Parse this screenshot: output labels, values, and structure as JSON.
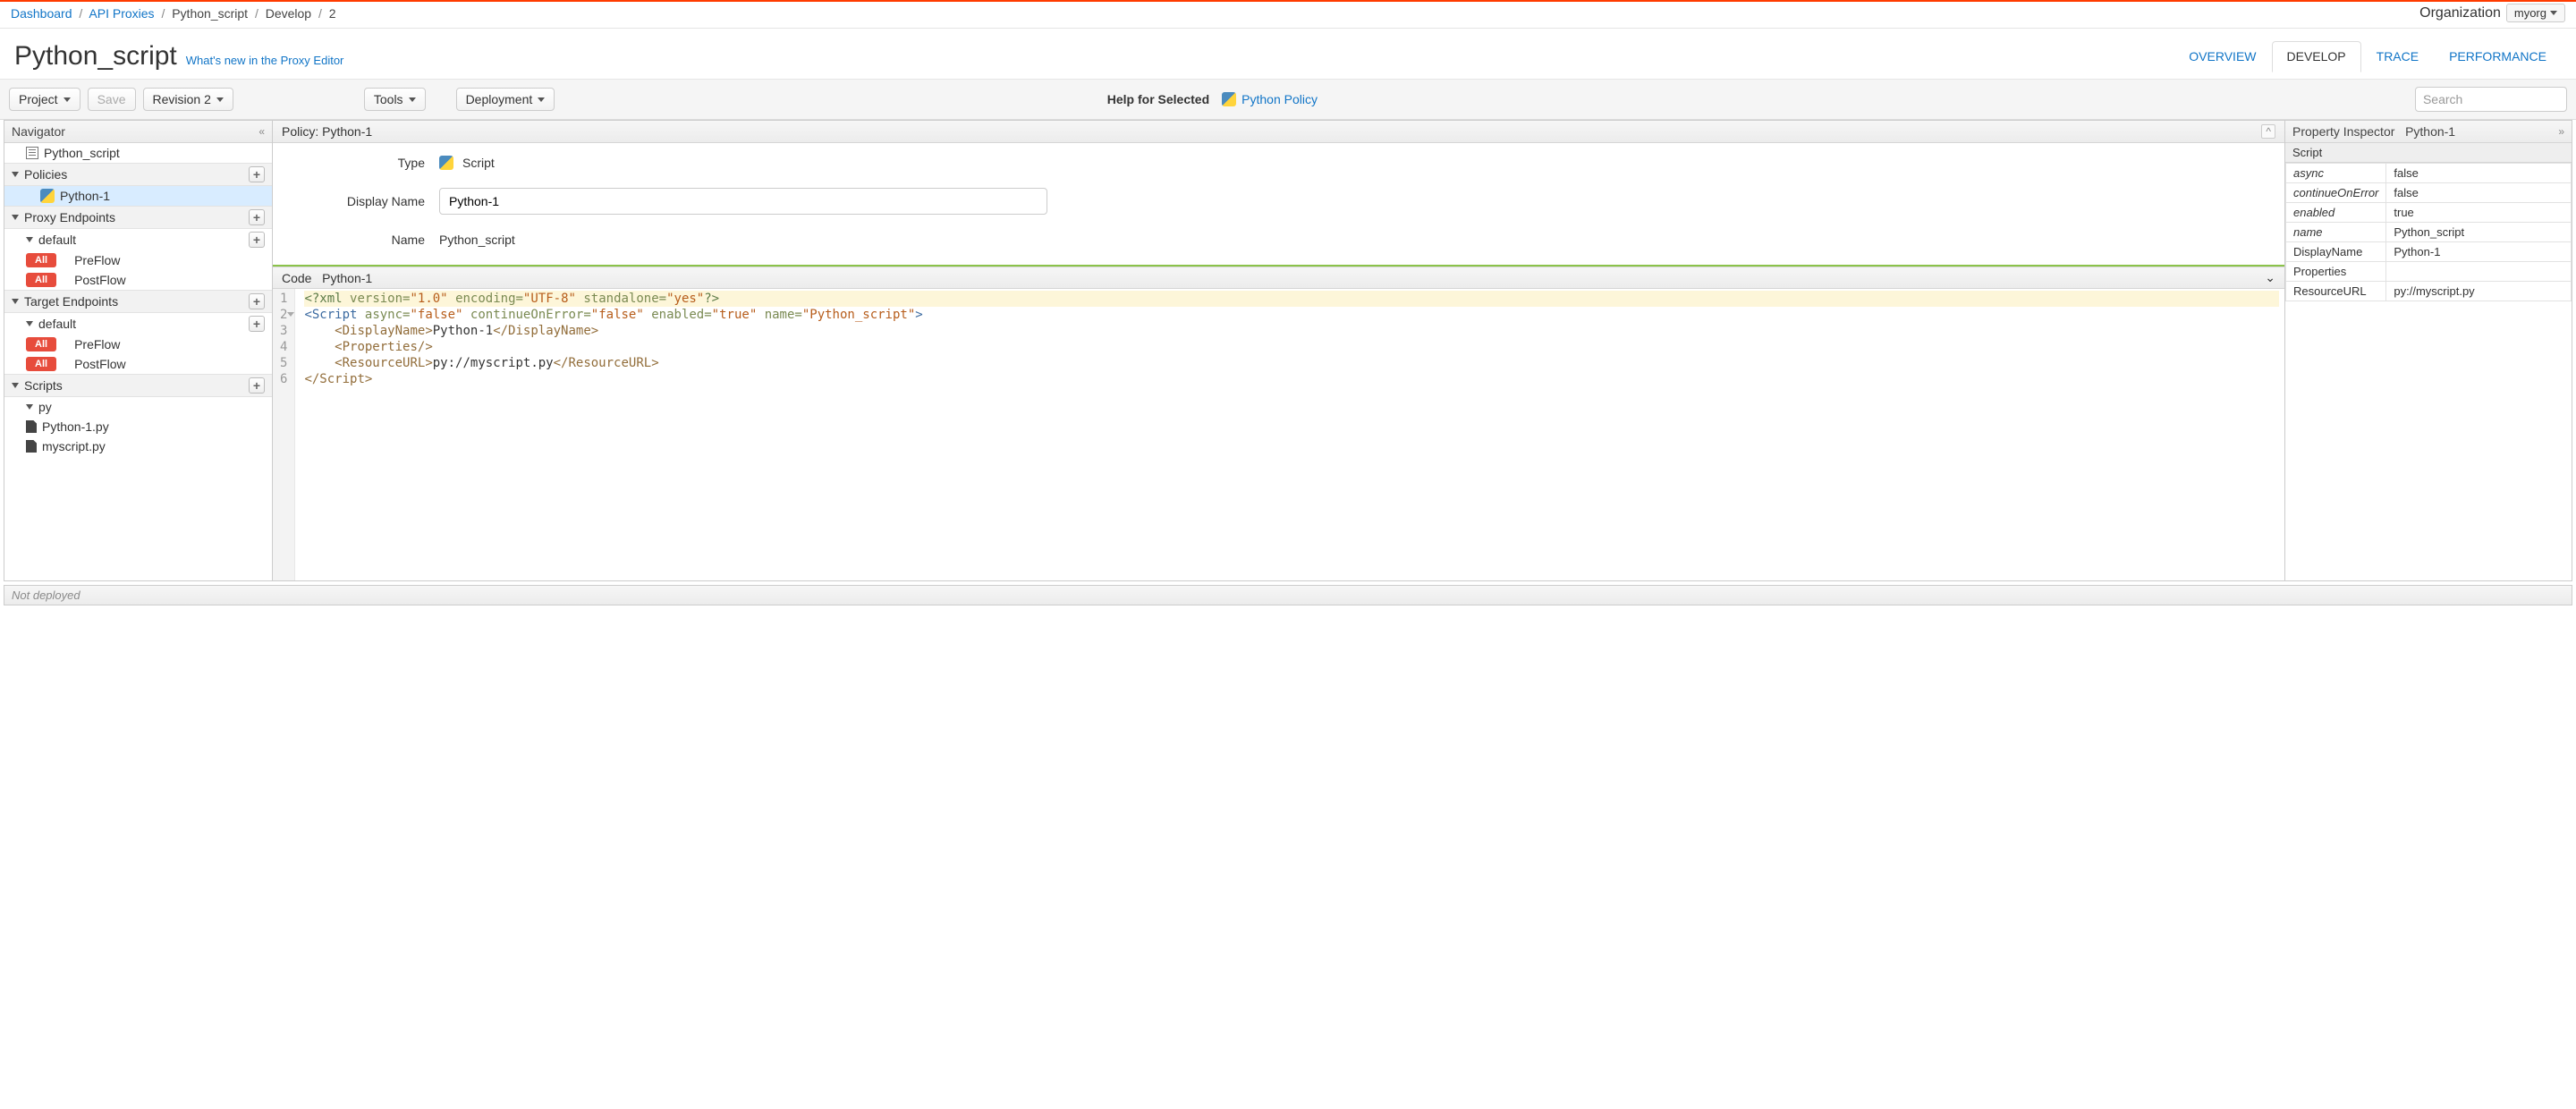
{
  "breadcrumb": {
    "dashboard": "Dashboard",
    "proxies": "API Proxies",
    "proxy_name": "Python_script",
    "develop": "Develop",
    "rev": "2"
  },
  "org_label": "Organization",
  "org_name": "myorg",
  "title": "Python_script",
  "whats_new": "What's new in the Proxy Editor",
  "tabs": {
    "overview": "OVERVIEW",
    "develop": "DEVELOP",
    "trace": "TRACE",
    "performance": "PERFORMANCE"
  },
  "toolbar": {
    "project": "Project",
    "save": "Save",
    "revision": "Revision 2",
    "tools": "Tools",
    "deployment": "Deployment",
    "help_label": "Help for Selected",
    "help_link": "Python Policy",
    "search_placeholder": "Search"
  },
  "navigator": {
    "title": "Navigator",
    "root": "Python_script",
    "policies_hdr": "Policies",
    "policy_items": [
      "Python-1"
    ],
    "proxy_ep_hdr": "Proxy Endpoints",
    "ep_default": "default",
    "preflow": "PreFlow",
    "postflow": "PostFlow",
    "target_ep_hdr": "Target Endpoints",
    "scripts_hdr": "Scripts",
    "scripts_lang": "py",
    "script_files": [
      "Python-1.py",
      "myscript.py"
    ],
    "badge_all": "All"
  },
  "center": {
    "header": "Policy: Python-1",
    "type_label": "Type",
    "type_value": "Script",
    "display_label": "Display Name",
    "display_value": "Python-1",
    "name_label": "Name",
    "name_value": "Python_script",
    "code_label": "Code",
    "code_name": "Python-1"
  },
  "code_xml": {
    "line1": {
      "open": "<?",
      "decl": "xml",
      "a1": "version=",
      "v1": "\"1.0\"",
      "a2": "encoding=",
      "v2": "\"UTF-8\"",
      "a3": "standalone=",
      "v3": "\"yes\"",
      "close": "?>"
    },
    "line2": {
      "open": "<",
      "tag": "Script",
      "a1": "async=",
      "v1": "\"false\"",
      "a2": "continueOnError=",
      "v2": "\"false\"",
      "a3": "enabled=",
      "v3": "\"true\"",
      "a4": "name=",
      "v4": "\"Python_script\"",
      "close": ">"
    },
    "line3": {
      "indent": "    ",
      "open": "<",
      "tag": "DisplayName",
      "mid": ">",
      "text": "Python-1",
      "copen": "</",
      "ctag": "DisplayName",
      "cclose": ">"
    },
    "line4": {
      "indent": "    ",
      "open": "<",
      "tag": "Properties",
      "close": "/>"
    },
    "line5": {
      "indent": "    ",
      "open": "<",
      "tag": "ResourceURL",
      "mid": ">",
      "text": "py://myscript.py",
      "copen": "</",
      "ctag": "ResourceURL",
      "cclose": ">"
    },
    "line6": {
      "open": "</",
      "tag": "Script",
      "close": ">"
    }
  },
  "inspector": {
    "title": "Property Inspector",
    "subtitle": "Python-1",
    "section": "Script",
    "rows": [
      {
        "k": "async",
        "v": "false",
        "italic": true
      },
      {
        "k": "continueOnError",
        "v": "false",
        "italic": true
      },
      {
        "k": "enabled",
        "v": "true",
        "italic": true
      },
      {
        "k": "name",
        "v": "Python_script",
        "italic": true
      },
      {
        "k": "DisplayName",
        "v": "Python-1",
        "italic": false
      },
      {
        "k": "Properties",
        "v": "",
        "italic": false
      },
      {
        "k": "ResourceURL",
        "v": "py://myscript.py",
        "italic": false
      }
    ]
  },
  "footer": "Not deployed"
}
